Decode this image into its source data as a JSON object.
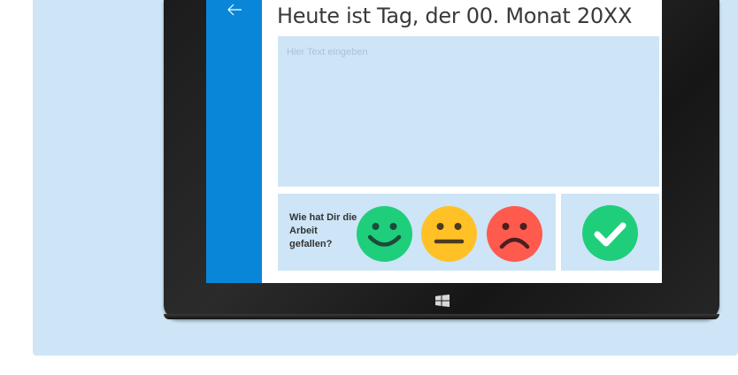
{
  "header": {
    "title": "Heute ist Tag, der 00. Monat 20XX",
    "back_icon": "arrow-left-icon"
  },
  "entry": {
    "placeholder": "Hier Text eingeben",
    "value": ""
  },
  "rating": {
    "question": "Wie hat Dir die Arbeit gefallen?",
    "options": [
      {
        "name": "happy",
        "color": "#1fce7b",
        "icon": "happy-face-icon"
      },
      {
        "name": "neutral",
        "color": "#ffc125",
        "icon": "neutral-face-icon"
      },
      {
        "name": "sad",
        "color": "#ff5a4e",
        "icon": "sad-face-icon"
      }
    ]
  },
  "submit": {
    "icon": "checkmark-icon",
    "color": "#1fce7b"
  },
  "colors": {
    "accent": "#0a86d9",
    "panel": "#cde5f6",
    "device": "#1f1f1f"
  },
  "device": {
    "button_icon": "windows-logo-icon"
  }
}
